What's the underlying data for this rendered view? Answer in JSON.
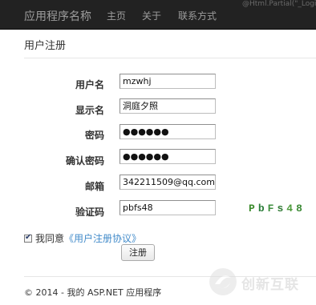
{
  "navbar": {
    "brand": "应用程序名称",
    "links": [
      "主页",
      "关于",
      "联系方式"
    ],
    "partial_text": "@Html.Partial(\"_LoginPa"
  },
  "page": {
    "title": "用户注册"
  },
  "form": {
    "fields": [
      {
        "label": "用户名",
        "value": "mzwhj"
      },
      {
        "label": "显示名",
        "value": "洞庭夕照"
      },
      {
        "label": "密码",
        "value": "●●●●●●"
      },
      {
        "label": "确认密码",
        "value": "●●●●●●"
      },
      {
        "label": "邮箱",
        "value": "342211509@qq.com"
      },
      {
        "label": "验证码",
        "value": "pbfs48"
      }
    ],
    "captcha": [
      "P",
      "b",
      "F",
      "s",
      "4",
      "8"
    ],
    "agree_prefix": "我同意",
    "agree_link": "《用户注册协议》",
    "agree_checked": true,
    "submit_label": "注册"
  },
  "footer": {
    "text": "© 2014 - 我的 ASP.NET 应用程序"
  },
  "watermark": {
    "text": "创新互联"
  }
}
